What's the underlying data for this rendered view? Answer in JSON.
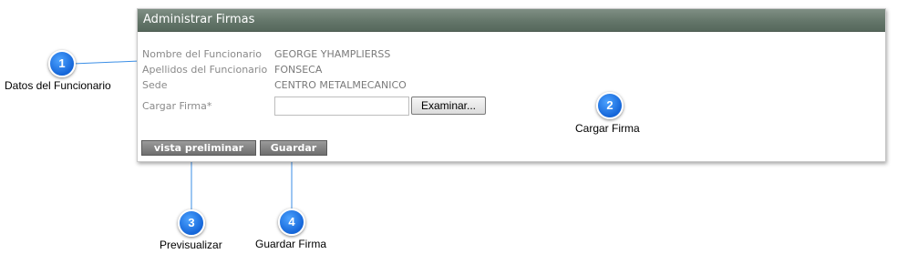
{
  "panel": {
    "title": "Administrar Firmas",
    "fields": [
      {
        "label": "Nombre del Funcionario",
        "value": "GEORGE YHAMPLIERSS"
      },
      {
        "label": "Apellidos del Funcionario",
        "value": "FONSECA"
      },
      {
        "label": "Sede",
        "value": "CENTRO METALMECANICO"
      }
    ],
    "upload": {
      "label": "Cargar Firma*",
      "browse_label": "Examinar..."
    },
    "buttons": {
      "preview": "vista preliminar",
      "save": "Guardar"
    }
  },
  "callouts": [
    {
      "number": "1",
      "label": "Datos del Funcionario"
    },
    {
      "number": "2",
      "label": "Cargar Firma"
    },
    {
      "number": "3",
      "label": "Previsualizar"
    },
    {
      "number": "4",
      "label": "Guardar Firma"
    }
  ],
  "colors": {
    "header": "#64766a",
    "callout": "#1465d8",
    "button": "#7f7f7f"
  }
}
